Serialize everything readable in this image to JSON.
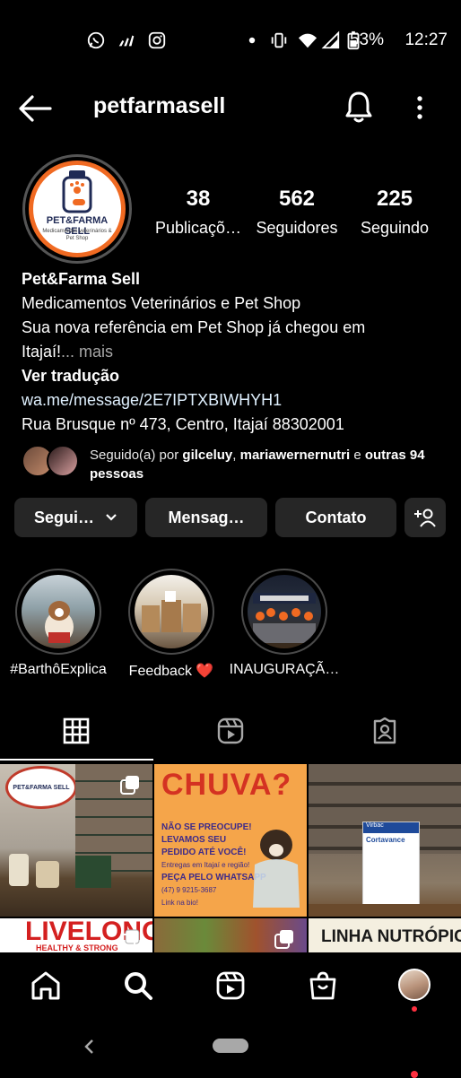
{
  "status_bar": {
    "battery": "53%",
    "time": "12:27",
    "left_icons": [
      "whatsapp-icon",
      "adidas-icon",
      "instagram-icon"
    ],
    "right_icons": [
      "dot-icon",
      "vibrate-icon",
      "wifi-icon",
      "signal-icon",
      "battery-icon"
    ]
  },
  "header": {
    "username": "petfarmasell"
  },
  "profile": {
    "avatar_title": "PET&FARMA SELL",
    "avatar_subtitle": "Medicamentos veterinários & Pet Shop",
    "stats": [
      {
        "value": "38",
        "label": "Publicaçõ…"
      },
      {
        "value": "562",
        "label": "Seguidores"
      },
      {
        "value": "225",
        "label": "Seguindo"
      }
    ]
  },
  "bio": {
    "name": "Pet&Farma Sell",
    "category": "Medicamentos Veterinários e Pet Shop",
    "line1": "Sua nova referência em Pet Shop já chegou em",
    "line2": "Itajaí!",
    "more": "... mais",
    "translate": "Ver tradução",
    "link": "wa.me/message/2E7IPTXBIWHYH1",
    "address": "Rua Brusque nº 473, Centro, Itajaí 88302001"
  },
  "followed_by": {
    "prefix": "Seguido(a) por ",
    "user1": "gilceluy",
    "sep": ", ",
    "user2": "mariawernernutri",
    "and": " e ",
    "others": "outras 94 pessoas"
  },
  "buttons": {
    "following": "Segui…",
    "message": "Mensag…",
    "contact": "Contato"
  },
  "highlights": [
    {
      "label": "#BarthôExplica"
    },
    {
      "label": "Feedback ❤️"
    },
    {
      "label": "INAUGURAÇÃ…"
    }
  ],
  "grid": {
    "post2_title": "CHUVA?",
    "post2_line1": "NÃO SE PREOCUPE!",
    "post2_line2": "LEVAMOS SEU",
    "post2_line3": "PEDIDO ATÉ VOCÊ!",
    "post2_line4": "Entregas em Itajaí e região!",
    "post2_line5": "PEÇA PELO WHATSAPP",
    "post2_line6": "(47) 9 9215-3687",
    "post2_line7": "Link na bio!",
    "post1_sign": "PET&FARMA SELL",
    "post3_box": "Cortavance",
    "post3_brand": "Virbac",
    "post4_text": "LIVELONG",
    "post4_sub": "HEALTHY & STRONG",
    "post6_text": "LINHA NUTRÓPICA"
  },
  "colors": {
    "accent_orange": "#f06a22",
    "button_bg": "#262626",
    "notification_red": "#ff3040"
  }
}
